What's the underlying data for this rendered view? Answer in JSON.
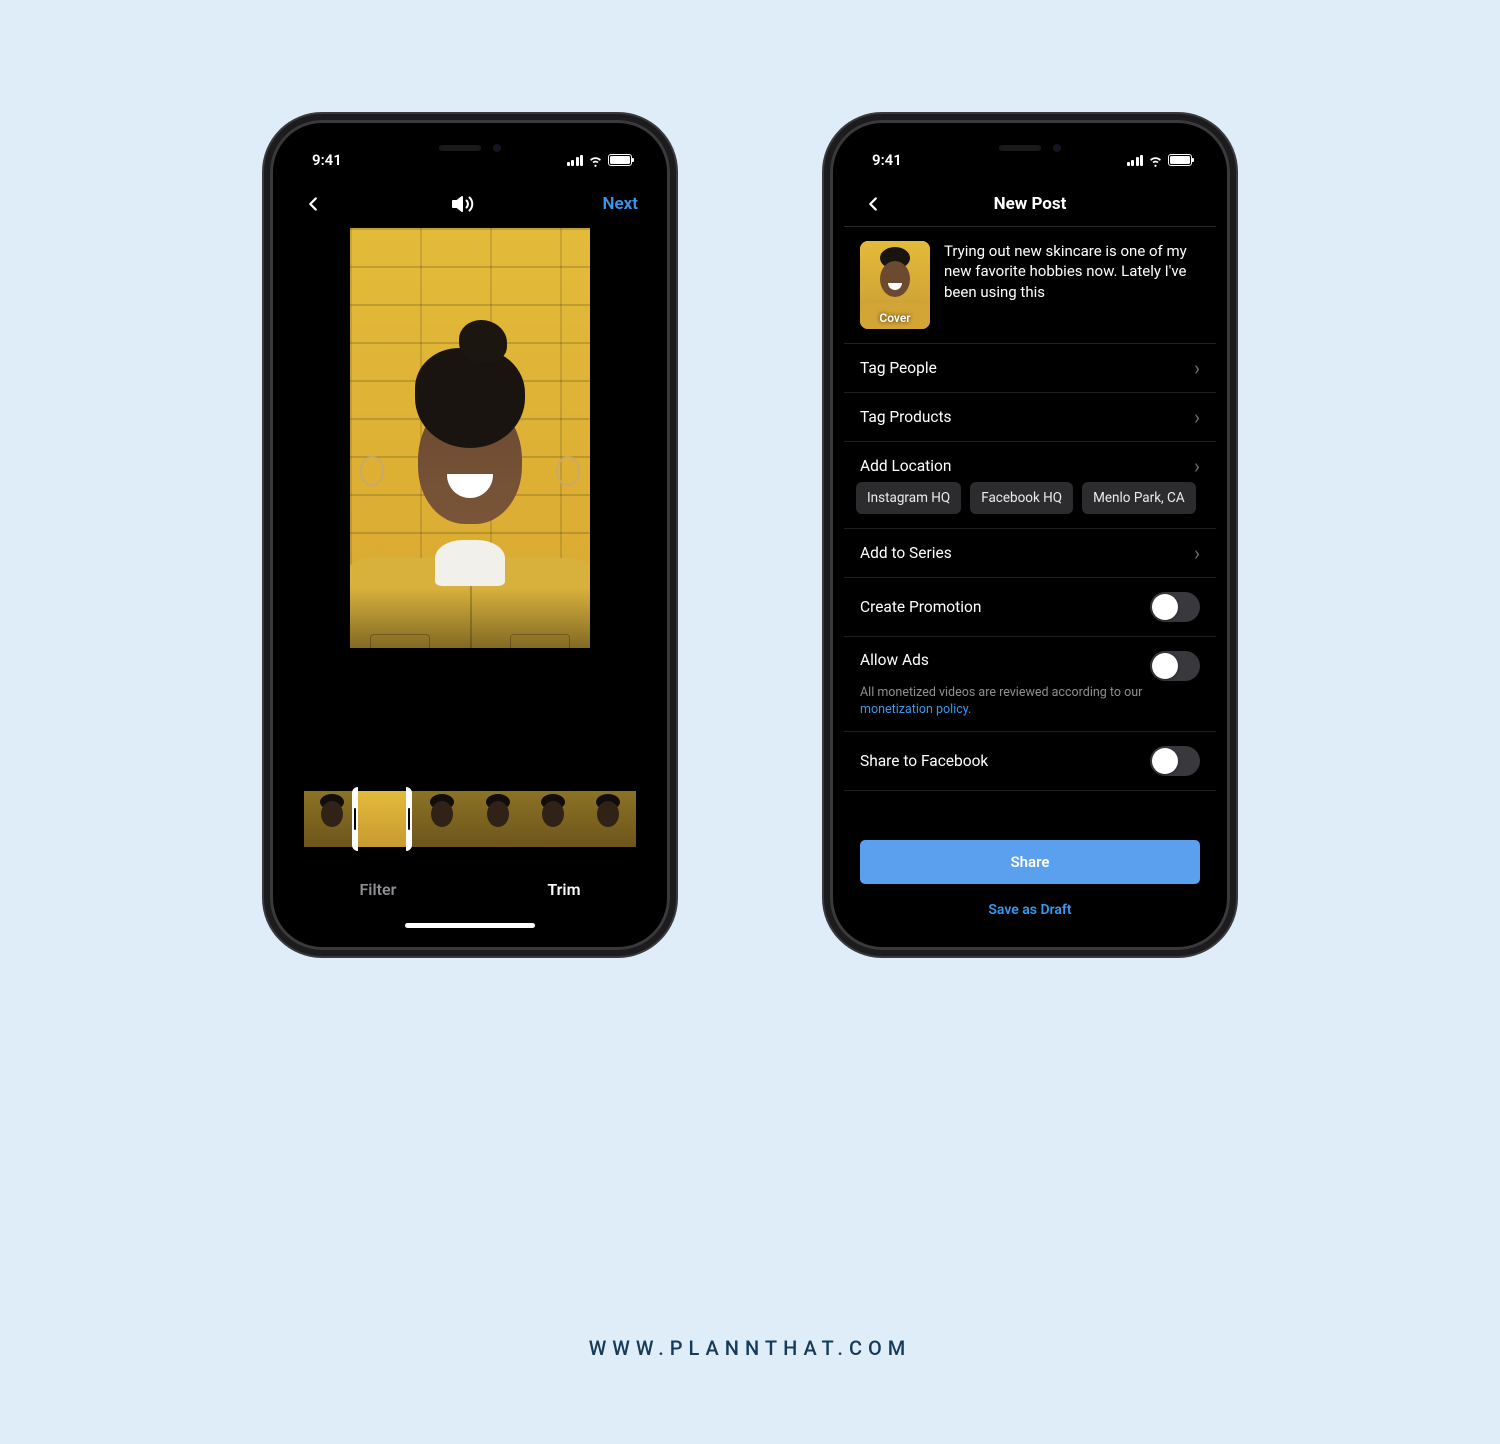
{
  "watermark": "WWW.PLANNTHAT.COM",
  "status": {
    "time": "9:41"
  },
  "phone1": {
    "nav": {
      "next": "Next"
    },
    "tabs": {
      "filter": "Filter",
      "trim": "Trim"
    }
  },
  "phone2": {
    "nav": {
      "title": "New Post"
    },
    "caption": "Trying out new skincare is one of my new favorite hobbies now. Lately I've been using this",
    "cover_label": "Cover",
    "rows": {
      "tag_people": "Tag People",
      "tag_products": "Tag Products",
      "add_location": "Add Location",
      "add_series": "Add to Series",
      "create_promo": "Create Promotion",
      "allow_ads": "Allow Ads",
      "ads_sub_a": "All monetized videos are reviewed according to our ",
      "ads_sub_link": "monetization policy",
      "ads_sub_b": ".",
      "share_fb": "Share to Facebook"
    },
    "chips": [
      "Instagram HQ",
      "Facebook HQ",
      "Menlo Park, CA"
    ],
    "share": "Share",
    "draft": "Save as Draft"
  }
}
